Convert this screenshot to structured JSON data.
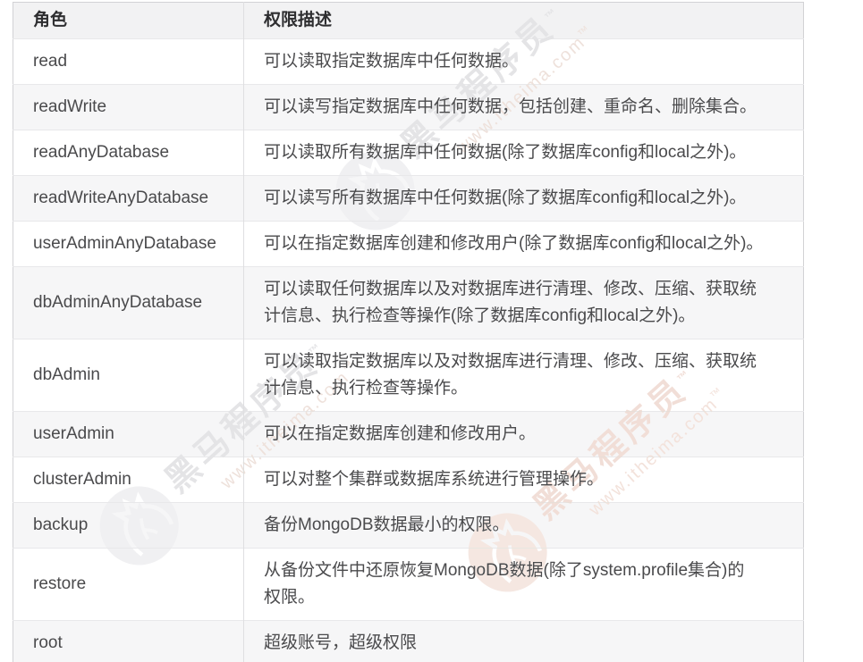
{
  "table": {
    "columns": {
      "role_label": "角色",
      "desc_label": "权限描述"
    },
    "rows": [
      {
        "role": "read",
        "desc": "可以读取指定数据库中任何数据。"
      },
      {
        "role": "readWrite",
        "desc": "可以读写指定数据库中任何数据，包括创建、重命名、删除集合。"
      },
      {
        "role": "readAnyDatabase",
        "desc": "可以读取所有数据库中任何数据(除了数据库config和local之外)。"
      },
      {
        "role": "readWriteAnyDatabase",
        "desc": "可以读写所有数据库中任何数据(除了数据库config和local之外)。"
      },
      {
        "role": "userAdminAnyDatabase",
        "desc": "可以在指定数据库创建和修改用户(除了数据库config和local之外)。"
      },
      {
        "role": "dbAdminAnyDatabase",
        "desc": "可以读取任何数据库以及对数据库进行清理、修改、压缩、获取统\n计信息、执行检查等操作(除了数据库config和local之外)。"
      },
      {
        "role": "dbAdmin",
        "desc": "可以读取指定数据库以及对数据库进行清理、修改、压缩、获取统\n计信息、执行检查等操作。"
      },
      {
        "role": "userAdmin",
        "desc": "可以在指定数据库创建和修改用户。"
      },
      {
        "role": "clusterAdmin",
        "desc": "可以对整个集群或数据库系统进行管理操作。"
      },
      {
        "role": "backup",
        "desc": "备份MongoDB数据最小的权限。"
      },
      {
        "role": "restore",
        "desc": "从备份文件中还原恢复MongoDB数据(除了system.profile集合)的\n权限。"
      },
      {
        "role": "root",
        "desc": "超级账号，超级权限"
      }
    ]
  },
  "watermark": {
    "title": "黑马程序员",
    "subtitle": "www.itheima.com",
    "tm": "™"
  },
  "colors": {
    "header_bg": "#f2f2f3",
    "stripe_bg": "#f6f6f7",
    "row_bg": "#ffffff",
    "outer_border": "#d2d2d5",
    "inner_border": "#e8e8ea",
    "column_divider": "#dfdfe1",
    "header_text": "#2e2e30",
    "body_text": "#4a4a4c",
    "watermark_gray": "#e4e4e6",
    "watermark_warm": "#f1ded7"
  }
}
